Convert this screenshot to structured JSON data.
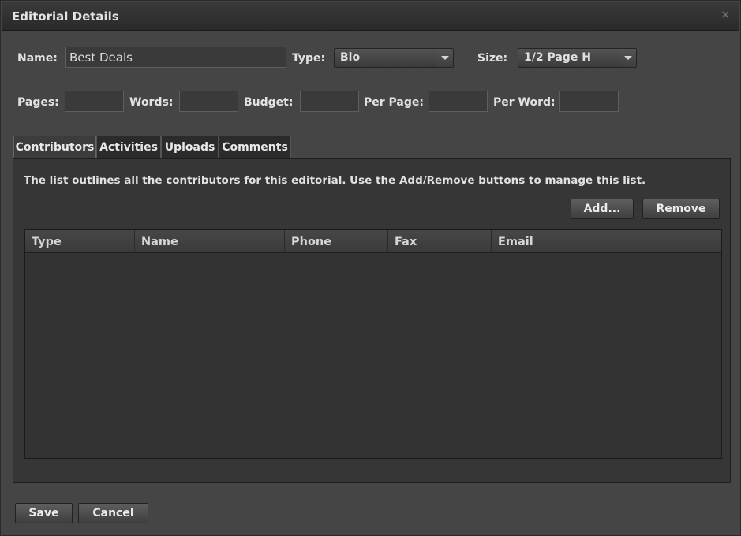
{
  "dialog": {
    "title": "Editorial Details",
    "close_glyph": "×"
  },
  "form": {
    "name_label": "Name:",
    "name_value": "Best Deals",
    "type_label": "Type:",
    "type_value": "Bio",
    "size_label": "Size:",
    "size_value": "1/2 Page H",
    "pages_label": "Pages:",
    "words_label": "Words:",
    "budget_label": "Budget:",
    "per_page_label": "Per Page:",
    "per_word_label": "Per Word:"
  },
  "tabs": [
    {
      "label": "Contributors",
      "active": true
    },
    {
      "label": "Activities",
      "active": false
    },
    {
      "label": "Uploads",
      "active": false
    },
    {
      "label": "Comments",
      "active": false
    }
  ],
  "contributors": {
    "description": "The list outlines all the contributors for this editorial. Use the Add/Remove buttons to manage this list.",
    "add_label": "Add...",
    "remove_label": "Remove",
    "columns": [
      "Type",
      "Name",
      "Phone",
      "Fax",
      "Email"
    ],
    "rows": []
  },
  "footer": {
    "save_label": "Save",
    "cancel_label": "Cancel"
  },
  "icons": {
    "close": "close-icon",
    "dropdown": "chevron-down-icon"
  }
}
